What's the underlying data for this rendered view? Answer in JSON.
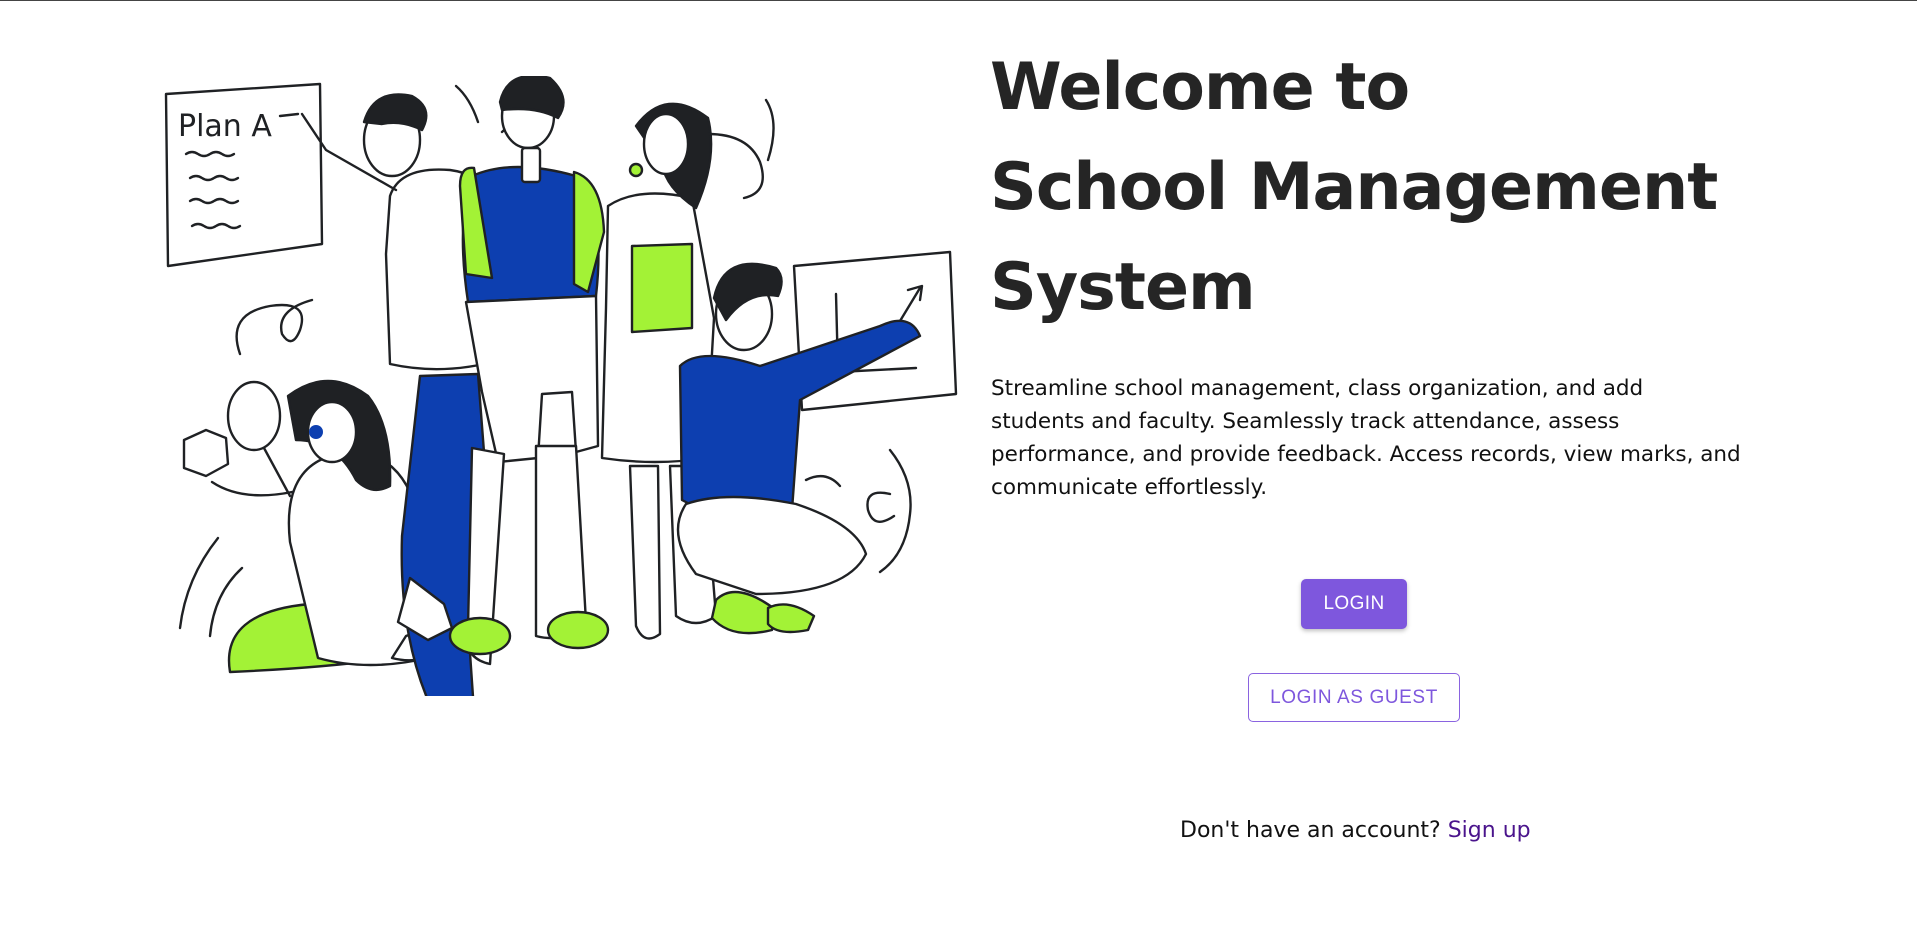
{
  "hero": {
    "illustration_icon": "people-planning-illustration",
    "whiteboard_text": "Plan A",
    "colors": {
      "accent_green": "#a3f236",
      "accent_blue": "#0d3fb0",
      "outline": "#1f2124"
    }
  },
  "welcome": {
    "line1": "Welcome to",
    "line2": "School Management",
    "line3": "System"
  },
  "description": "Streamline school management, class organization, and add students and faculty. Seamlessly track attendance, assess performance, and provide feedback. Access records, view marks, and communicate effortlessly.",
  "actions": {
    "login_label": "LOGIN",
    "guest_label": "LOGIN AS GUEST",
    "primary_color": "#7e57dd"
  },
  "signup": {
    "prompt": "Don't have an account?",
    "link_label": "Sign up",
    "link_color": "#4a148c"
  }
}
